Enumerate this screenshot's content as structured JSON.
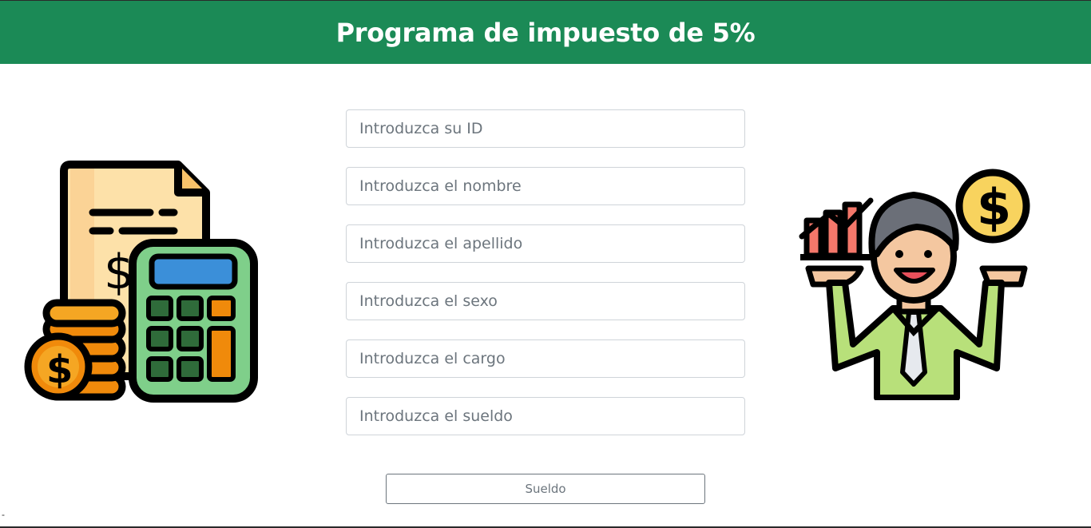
{
  "colors": {
    "brand": "#1b8a56",
    "header_text": "#ffffff",
    "border": "#cfd4d9"
  },
  "header": {
    "title": "Programa de impuesto de 5%"
  },
  "form": {
    "fields": [
      {
        "name": "id-input",
        "placeholder": "Introduzca su ID",
        "value": ""
      },
      {
        "name": "nombre-input",
        "placeholder": "Introduzca el nombre",
        "value": ""
      },
      {
        "name": "apellido-input",
        "placeholder": "Introduzca el apellido",
        "value": ""
      },
      {
        "name": "sexo-input",
        "placeholder": "Introduzca el sexo",
        "value": ""
      },
      {
        "name": "cargo-input",
        "placeholder": "Introduzca el cargo",
        "value": ""
      },
      {
        "name": "sueldo-input",
        "placeholder": "Introduzca el sueldo",
        "value": ""
      }
    ],
    "submit_label": "Sueldo"
  },
  "illustrations": {
    "left": "calculator-coins-icon",
    "right": "businessman-money-icon"
  },
  "footer": {
    "mark": "-"
  }
}
